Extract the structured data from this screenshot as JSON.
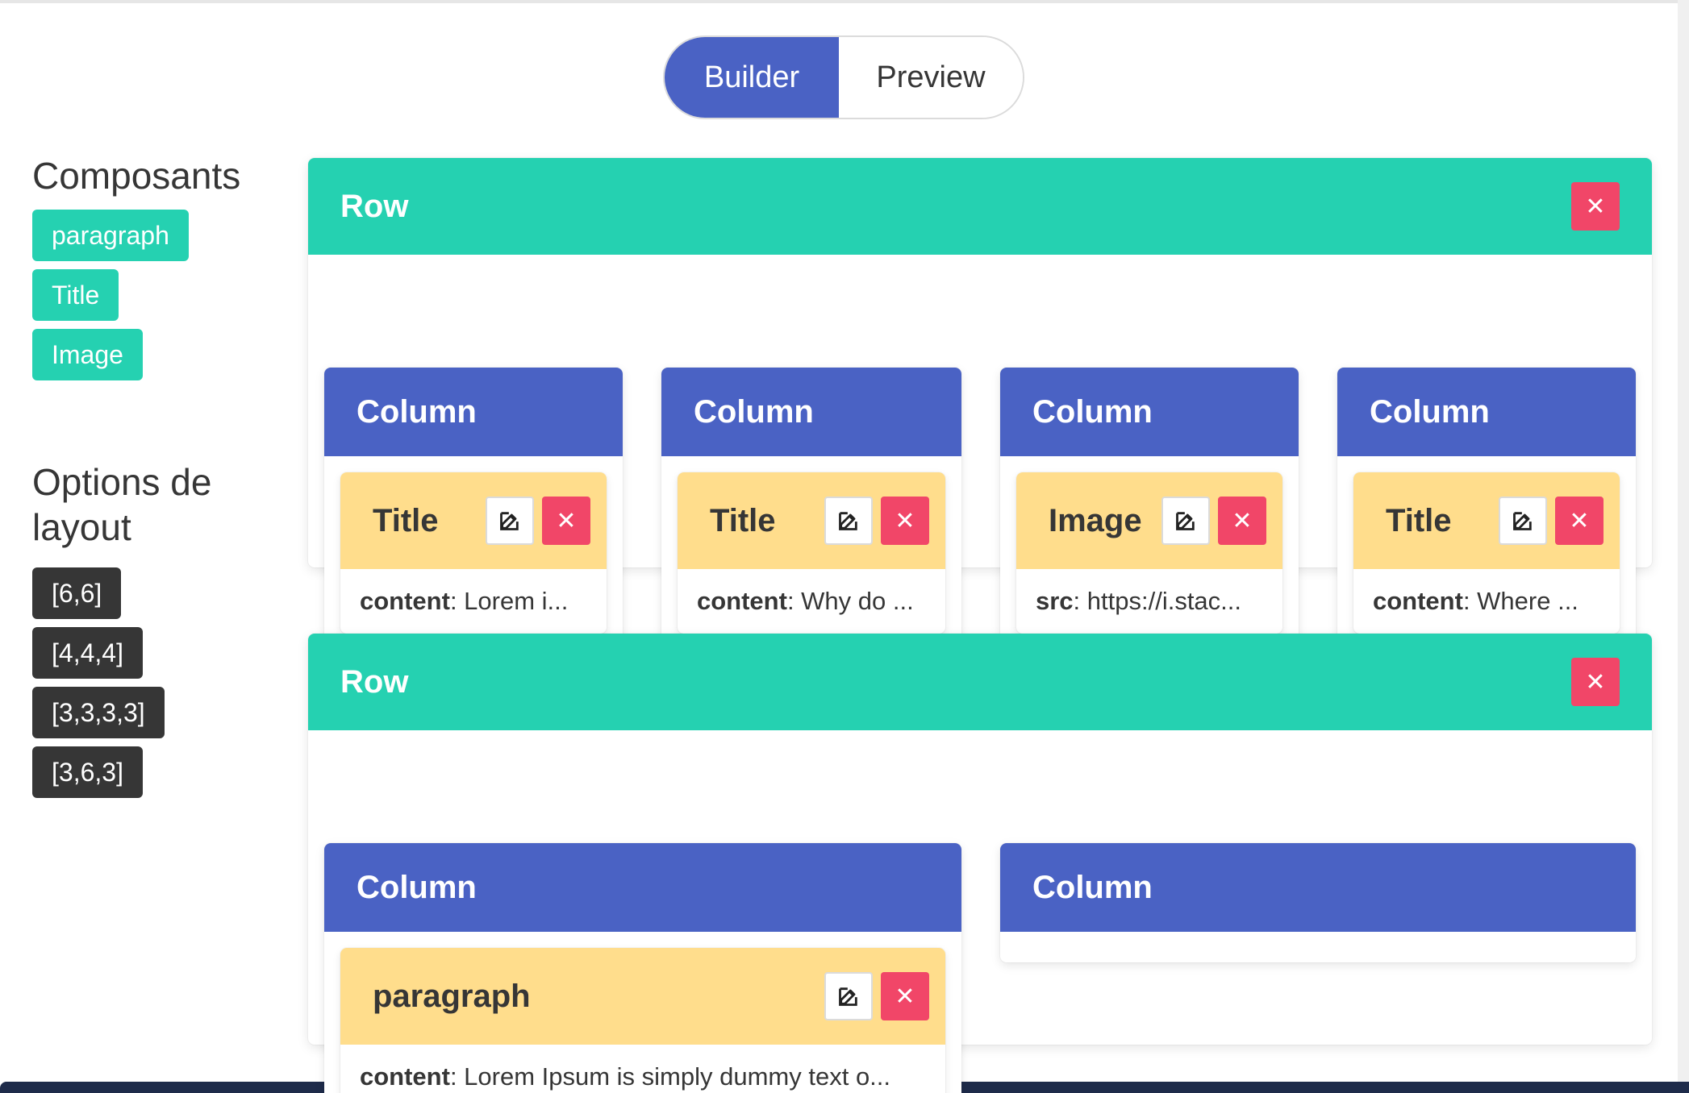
{
  "toggle": {
    "builder": "Builder",
    "preview": "Preview"
  },
  "sidebar": {
    "components_title": "Composants",
    "components": [
      "paragraph",
      "Title",
      "Image"
    ],
    "layout_title": "Options de layout",
    "layouts": [
      "[6,6]",
      "[4,4,4]",
      "[3,3,3,3]",
      "[3,6,3]"
    ]
  },
  "rows": [
    {
      "title": "Row",
      "columns": [
        {
          "title": "Column",
          "element": {
            "title": "Title",
            "key": "content",
            "value": ": Lorem i..."
          }
        },
        {
          "title": "Column",
          "element": {
            "title": "Title",
            "key": "content",
            "value": ": Why do ..."
          }
        },
        {
          "title": "Column",
          "element": {
            "title": "Image",
            "key": "src",
            "value": ": https://i.stac..."
          }
        },
        {
          "title": "Column",
          "element": {
            "title": "Title",
            "key": "content",
            "value": ": Where ..."
          }
        }
      ]
    },
    {
      "title": "Row",
      "columns": [
        {
          "title": "Column",
          "element": {
            "title": "paragraph",
            "key": "content",
            "value": ": Lorem Ipsum is simply dummy text o..."
          }
        },
        {
          "title": "Column"
        }
      ]
    }
  ],
  "icons": {
    "edit": "edit-icon",
    "delete": "close-icon"
  },
  "colors": {
    "primary": "#4a62c4",
    "teal": "#25d1b1",
    "danger": "#f14668",
    "warning": "#ffdd8c",
    "dark": "#363636"
  }
}
